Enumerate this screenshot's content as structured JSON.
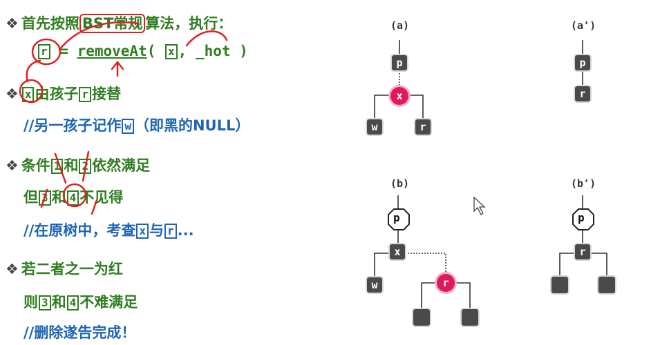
{
  "left": {
    "l1_bullet": "❖",
    "l1_text": "首先按照",
    "l1_bst": "BST常规",
    "l1_rest": "算法，执行：",
    "l2_r": "r",
    "l2_eq": " = ",
    "l2_fn": "removeAt",
    "l2_open": "( ",
    "l2_x": "x",
    "l2_hot": ", _hot )",
    "l3_bullet": "❖",
    "l3_x": "x",
    "l3_mid": "由孩子",
    "l3_r": "r",
    "l3_end": "接替",
    "l4_pre": "//另一孩子记作",
    "l4_w": "w",
    "l4_end": "（即黑的NULL）",
    "l5_bullet": "❖",
    "l5_pre": "条件",
    "l5_1": "1",
    "l5_and": "和",
    "l5_2": "2",
    "l5_end": "依然满足",
    "l6_pre": "但",
    "l6_3": "3",
    "l6_and": "和",
    "l6_4": "4",
    "l6_end": "不见得",
    "l7_pre": "//在原树中，考查",
    "l7_x": "x",
    "l7_and": "与",
    "l7_r": "r",
    "l7_end": "...",
    "l8_bullet": "❖",
    "l8_text": "若二者之一为红",
    "l9_pre": "则",
    "l9_3": "3",
    "l9_and": "和",
    "l9_4": "4",
    "l9_end": "不难满足",
    "l10_text": "//删除遂告完成！"
  },
  "diagrams": {
    "a_label": "(a)",
    "a2_label": "(a')",
    "b_label": "(b)",
    "b2_label": "(b')",
    "a_p": "p",
    "a_x": "x",
    "a_w": "w",
    "a_r": "r",
    "a2_p": "p",
    "a2_r": "r",
    "b_p": "p",
    "b_x": "x",
    "b_w": "w",
    "b_r": "r",
    "b2_p": "p",
    "b2_r": "r"
  },
  "colors": {
    "green": "#2e7d1f",
    "blue": "#1e64b4",
    "red": "#e0185c",
    "node": "#4a4a4a"
  }
}
